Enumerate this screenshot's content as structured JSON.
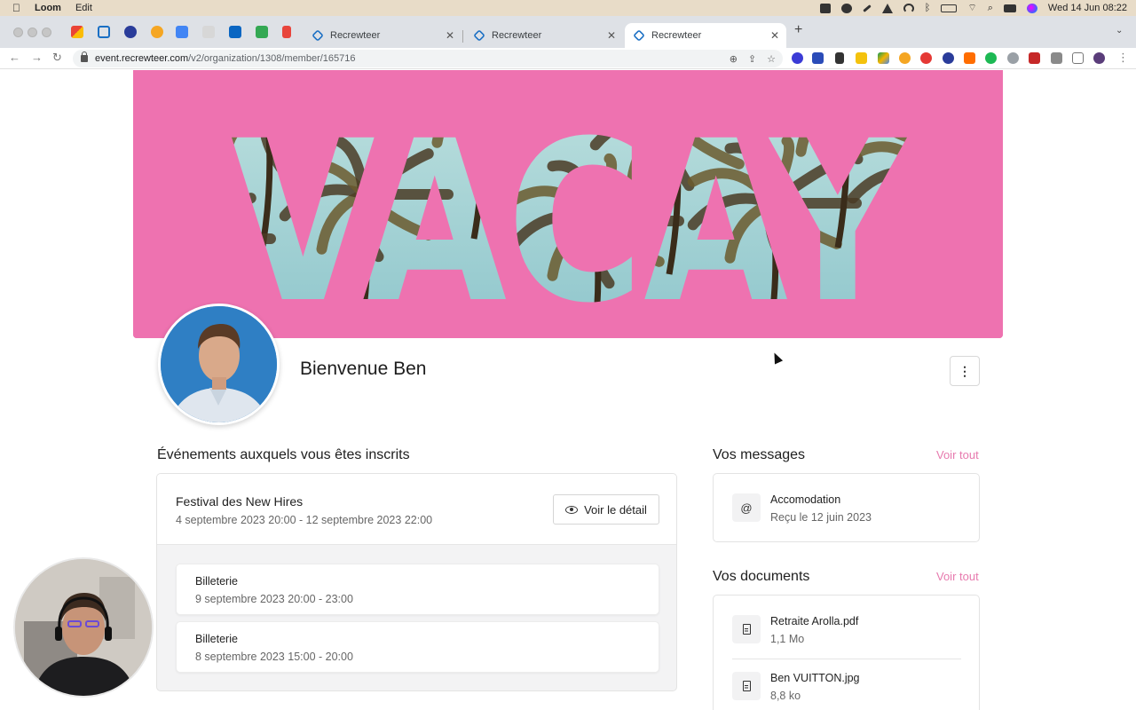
{
  "menubar": {
    "app_name": "Loom",
    "menu_edit": "Edit",
    "clock": "Wed 14 Jun  08:22"
  },
  "browser": {
    "tabs": [
      {
        "title": "Recrewteer"
      },
      {
        "title": "Recrewteer"
      },
      {
        "title": "Recrewteer"
      }
    ],
    "url_host": "event.recrewteer.com",
    "url_path": "/v2/organization/1308/member/165716"
  },
  "banner": {
    "text": "VACAY",
    "colors": {
      "background": "#ee72b0",
      "sky": "#a9d4d6",
      "palm": "#4a3b24"
    }
  },
  "profile": {
    "welcome": "Bienvenue Ben"
  },
  "events": {
    "title": "Événements auxquels vous êtes inscrits",
    "event_name": "Festival des New Hires",
    "event_dates": "4 septembre 2023 20:00 - 12 septembre 2023 22:00",
    "detail_button": "Voir le détail",
    "tickets": [
      {
        "title": "Billeterie",
        "date": "9 septembre 2023 20:00 - 23:00"
      },
      {
        "title": "Billeterie",
        "date": "8 septembre 2023 15:00 - 20:00"
      }
    ]
  },
  "messages": {
    "title": "Vos messages",
    "see_all": "Voir tout",
    "items": [
      {
        "title": "Accomodation",
        "sub": "Reçu le 12 juin 2023",
        "icon": "at-icon"
      }
    ]
  },
  "documents": {
    "title": "Vos documents",
    "see_all": "Voir tout",
    "items": [
      {
        "name": "Retraite Arolla.pdf",
        "size": "1,1 Mo",
        "icon": "document-icon"
      },
      {
        "name": "Ben VUITTON.jpg",
        "size": "8,8 ko",
        "icon": "document-icon"
      }
    ]
  },
  "accent_color": "#e77aae"
}
